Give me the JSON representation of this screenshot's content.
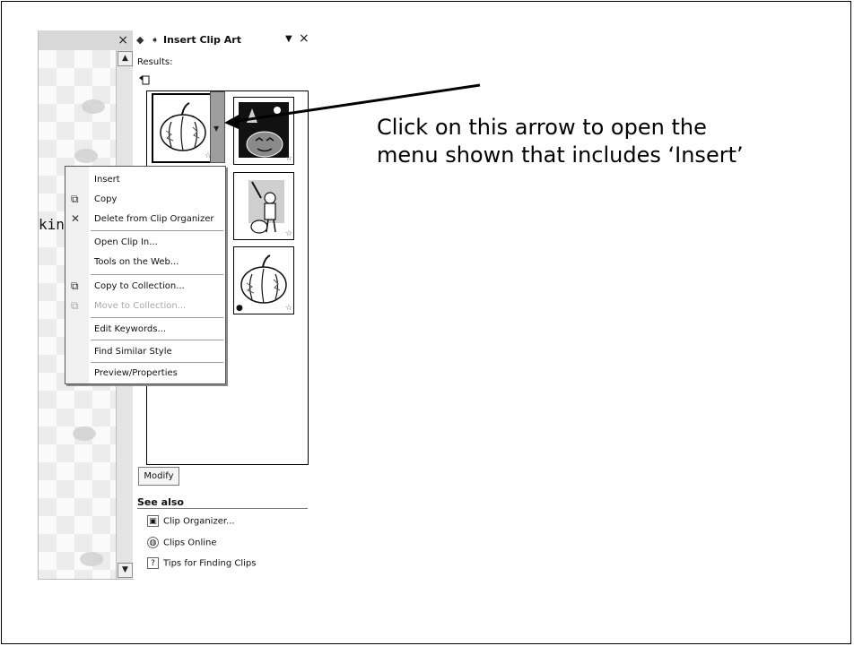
{
  "taskpane": {
    "title": "Insert Clip Art",
    "results_label": "Results:",
    "modify_label": "Modify",
    "see_also_label": "See also",
    "links": [
      {
        "label": "Clip Organizer...",
        "icon": "clip-organizer-icon"
      },
      {
        "label": "Clips Online",
        "icon": "globe-icon"
      },
      {
        "label": "Tips for Finding Clips",
        "icon": "help-icon"
      }
    ]
  },
  "document": {
    "visible_text": "kin f"
  },
  "context_menu": {
    "items": [
      {
        "label": "Insert",
        "icon": "",
        "enabled": true
      },
      {
        "label": "Copy",
        "icon": "copy-icon",
        "enabled": true
      },
      {
        "label": "Delete from Clip Organizer",
        "icon": "delete-icon",
        "enabled": true
      },
      {
        "label": "Open Clip In...",
        "icon": "",
        "enabled": true
      },
      {
        "label": "Tools on the Web...",
        "icon": "",
        "enabled": true
      },
      {
        "label": "Copy to Collection...",
        "icon": "copy-collection-icon",
        "enabled": true
      },
      {
        "label": "Move to Collection...",
        "icon": "move-collection-icon",
        "enabled": false
      },
      {
        "label": "Edit Keywords...",
        "icon": "",
        "enabled": true
      },
      {
        "label": "Find Similar Style",
        "icon": "",
        "enabled": true
      },
      {
        "label": "Preview/Properties",
        "icon": "",
        "enabled": true
      }
    ]
  },
  "annotation": {
    "line1": "Click on this arrow to open the",
    "line2": "menu shown that includes ‘Insert’"
  }
}
